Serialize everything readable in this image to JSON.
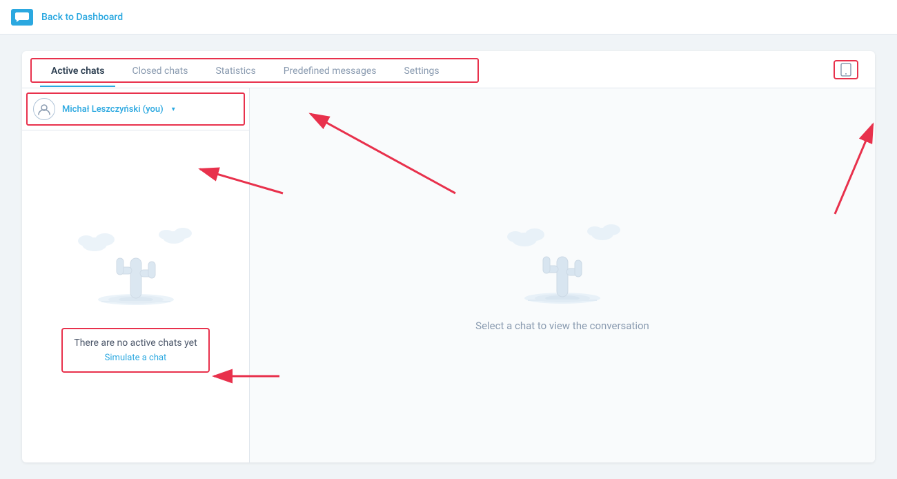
{
  "topbar": {
    "back_label": "Back to Dashboard"
  },
  "tabs": {
    "items": [
      {
        "id": "active-chats",
        "label": "Active chats",
        "active": true
      },
      {
        "id": "closed-chats",
        "label": "Closed chats",
        "active": false
      },
      {
        "id": "statistics",
        "label": "Statistics",
        "active": false
      },
      {
        "id": "predefined-messages",
        "label": "Predefined messages",
        "active": false
      },
      {
        "id": "settings",
        "label": "Settings",
        "active": false
      }
    ]
  },
  "agent": {
    "name": "Michał Leszczyński (you)"
  },
  "left_panel": {
    "empty_text": "There are no active chats yet",
    "simulate_label": "Simulate a chat"
  },
  "right_panel": {
    "select_text": "Select a chat to view the conversation"
  }
}
